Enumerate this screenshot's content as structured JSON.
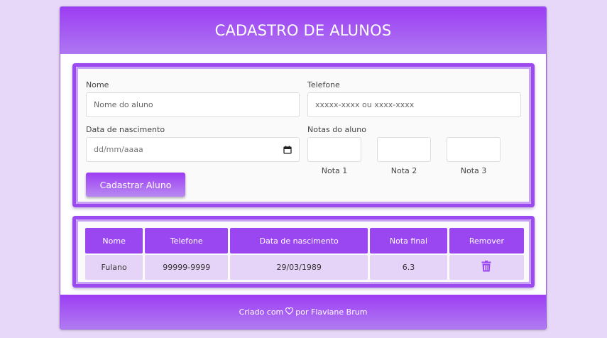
{
  "header": {
    "title": "CADASTRO DE ALUNOS"
  },
  "form": {
    "name_label": "Nome",
    "name_placeholder": "Nome do aluno",
    "phone_label": "Telefone",
    "phone_placeholder": "xxxxx-xxxx ou xxxx-xxxx",
    "birth_label": "Data de nascimento",
    "birth_placeholder": "dd/mm/aaaa",
    "grades_label": "Notas do aluno",
    "grade_labels": [
      "Nota 1",
      "Nota 2",
      "Nota 3"
    ],
    "submit_label": "Cadastrar Aluno"
  },
  "table": {
    "headers": [
      "Nome",
      "Telefone",
      "Data de nascimento",
      "Nota final",
      "Remover"
    ],
    "rows": [
      {
        "name": "Fulano",
        "phone": "99999-9999",
        "birth": "29/03/1989",
        "final_grade": "6.3",
        "remove_icon": "trash-icon"
      }
    ]
  },
  "footer": {
    "prefix": "Criado com",
    "icon": "heart-icon",
    "suffix": "por Flaviane Brum"
  },
  "colors": {
    "accent": "#9a47f1",
    "background": "#e7d7f8",
    "row_bg": "#e6d4f8",
    "grade_text": "#2e7d32"
  }
}
